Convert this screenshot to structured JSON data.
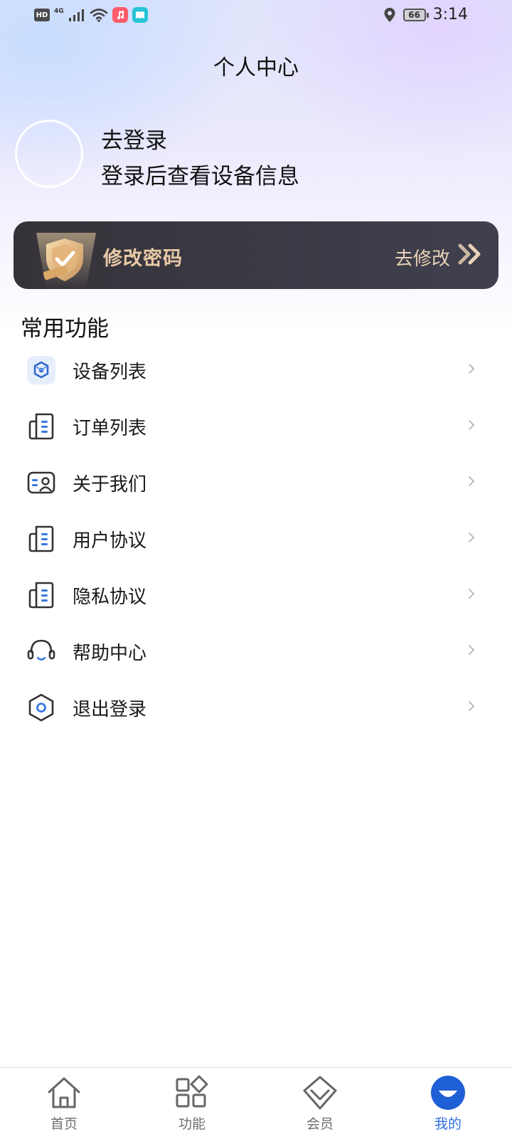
{
  "status_bar": {
    "hd": "HD",
    "network": "4G",
    "battery": "66",
    "time": "3:14"
  },
  "header": {
    "title": "个人中心"
  },
  "profile": {
    "login_title": "去登录",
    "login_subtitle": "登录后查看设备信息"
  },
  "password_card": {
    "title": "修改密码",
    "action": "去修改"
  },
  "common": {
    "section_title": "常用功能",
    "items": [
      {
        "label": "设备列表",
        "icon": "device-icon"
      },
      {
        "label": "订单列表",
        "icon": "document-icon"
      },
      {
        "label": "关于我们",
        "icon": "id-card-icon"
      },
      {
        "label": "用户协议",
        "icon": "document-icon"
      },
      {
        "label": "隐私协议",
        "icon": "document-icon"
      },
      {
        "label": "帮助中心",
        "icon": "headset-icon"
      },
      {
        "label": "退出登录",
        "icon": "hexagon-icon"
      }
    ]
  },
  "tabbar": {
    "items": [
      {
        "label": "首页",
        "icon": "home-icon"
      },
      {
        "label": "功能",
        "icon": "grid-icon"
      },
      {
        "label": "会员",
        "icon": "diamond-icon"
      },
      {
        "label": "我的",
        "icon": "profile-icon",
        "active": true
      }
    ]
  },
  "colors": {
    "accent": "#2b6de0",
    "card_bg": "#3b3a45",
    "card_text": "#e9c9a6"
  }
}
